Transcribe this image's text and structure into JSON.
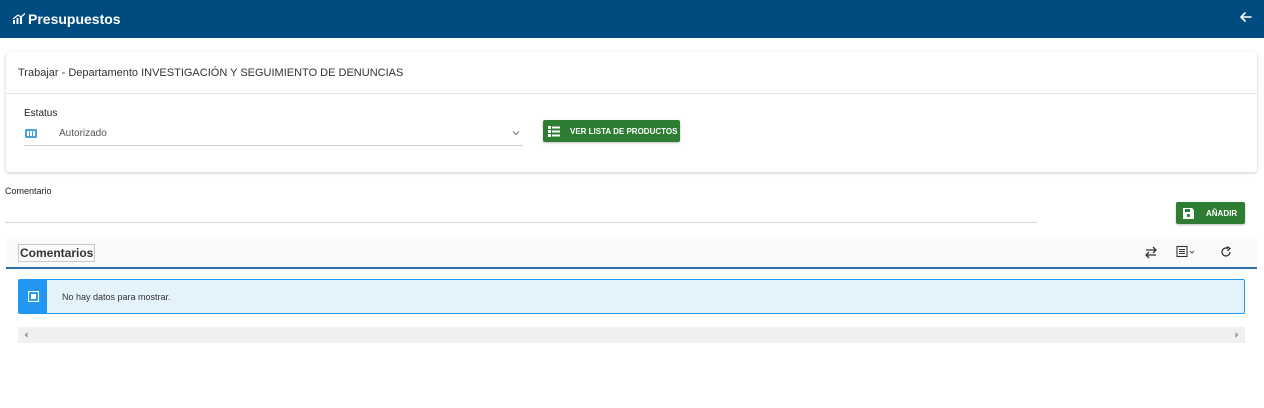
{
  "app": {
    "title": "Presupuestos",
    "icons": {
      "brand": "chart-trend-icon",
      "back": "arrow-left-icon"
    },
    "colors": {
      "header": "#004b80",
      "button": "#2e7d32",
      "info": "#2196f3",
      "info_bg": "#e4f2fb"
    }
  },
  "card": {
    "header_text": "Trabajar - Departamento INVESTIGACIÓN Y SEGUIMIENTO DE DENUNCIAS",
    "status_label": "Estatus",
    "status_value": "Autorizado",
    "products_button": "VER LISTA DE PRODUCTOS"
  },
  "comment": {
    "label": "Comentario",
    "value": "",
    "add_button": "AÑADIR"
  },
  "grid": {
    "title": "Comentarios",
    "empty_message": "No hay datos para mostrar.",
    "tools": [
      "swap-icon",
      "column-chooser-icon",
      "refresh-icon"
    ]
  }
}
